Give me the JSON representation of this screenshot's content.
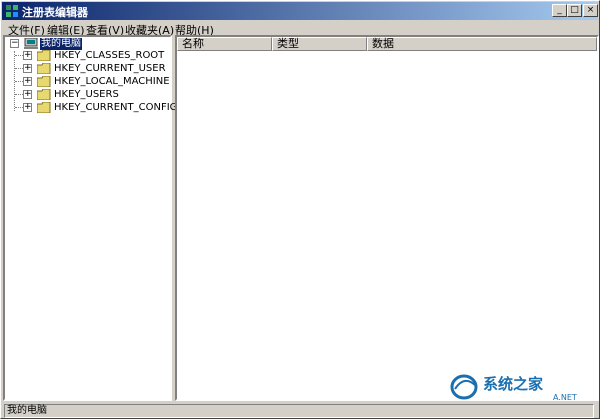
{
  "window": {
    "title": "注册表编辑器",
    "icon": "regedit-icon",
    "controls": {
      "minimize": "_",
      "maximize": "□",
      "close": "×"
    }
  },
  "menu": [
    {
      "label": "文件(F)"
    },
    {
      "label": "编辑(E)"
    },
    {
      "label": "查看(V)"
    },
    {
      "label": "收藏夹(A)"
    },
    {
      "label": "帮助(H)"
    }
  ],
  "tree": {
    "root": {
      "label": "我的电脑",
      "expanded": true,
      "selected": true,
      "expander": "−",
      "icon": "computer-icon"
    },
    "children": [
      {
        "label": "HKEY_CLASSES_ROOT",
        "expander": "+",
        "icon": "folder-icon"
      },
      {
        "label": "HKEY_CURRENT_USER",
        "expander": "+",
        "icon": "folder-icon"
      },
      {
        "label": "HKEY_LOCAL_MACHINE",
        "expander": "+",
        "icon": "folder-icon"
      },
      {
        "label": "HKEY_USERS",
        "expander": "+",
        "icon": "folder-icon"
      },
      {
        "label": "HKEY_CURRENT_CONFIG",
        "expander": "+",
        "icon": "folder-icon"
      }
    ]
  },
  "list": {
    "columns": [
      "名称",
      "类型",
      "数据"
    ],
    "rows": []
  },
  "status": {
    "text": "我的电脑"
  },
  "watermark": {
    "text": "系统之家",
    "subtext": "A.NET"
  },
  "colors": {
    "titlebar_start": "#0a246a",
    "titlebar_end": "#a6caf0",
    "selection": "#0a246a",
    "face": "#d4d0c8"
  }
}
